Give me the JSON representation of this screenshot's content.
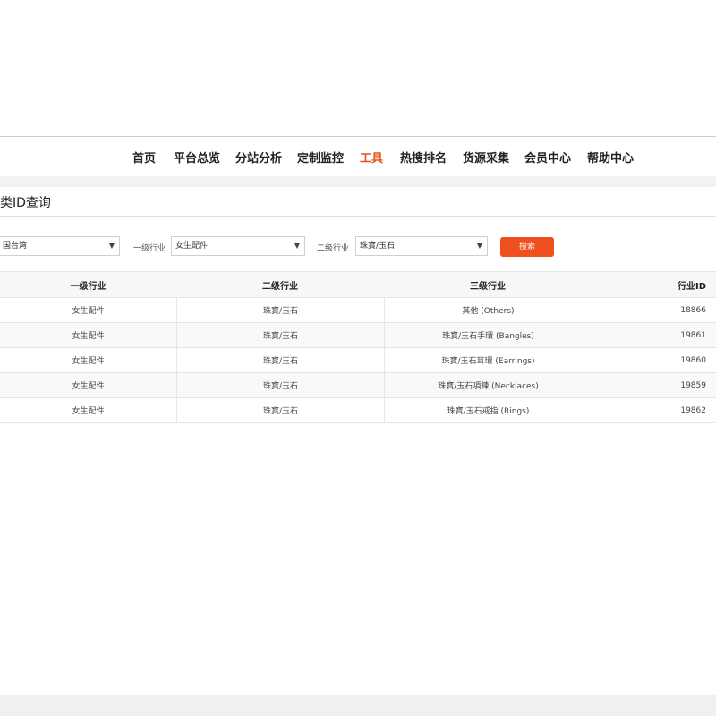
{
  "nav": {
    "items": [
      {
        "label": "首页"
      },
      {
        "label": "平台总览"
      },
      {
        "label": "分站分析"
      },
      {
        "label": "定制监控"
      },
      {
        "label": "工具"
      },
      {
        "label": "热搜排名"
      },
      {
        "label": "货源采集"
      },
      {
        "label": "会员中心"
      },
      {
        "label": "帮助中心"
      }
    ],
    "active": "工具",
    "active_color": "#e8501c"
  },
  "page": {
    "title": "类ID查询"
  },
  "filters": {
    "site_select": {
      "value": "国台湾"
    },
    "level1": {
      "label": "一级行业",
      "value": "女生配件"
    },
    "level2": {
      "label": "二级行业",
      "value": "珠寶/玉石"
    },
    "search_button": {
      "label": "搜索",
      "color": "#f0501d"
    }
  },
  "table": {
    "headers": [
      "一级行业",
      "二级行业",
      "三级行业",
      "行业ID"
    ],
    "rows": [
      [
        "女生配件",
        "珠寶/玉石",
        "其他 (Others)",
        "18866"
      ],
      [
        "女生配件",
        "珠寶/玉石",
        "珠寶/玉石手環 (Bangles)",
        "19861"
      ],
      [
        "女生配件",
        "珠寶/玉石",
        "珠寶/玉石耳環 (Earrings)",
        "19860"
      ],
      [
        "女生配件",
        "珠寶/玉石",
        "珠寶/玉石項鍊 (Necklaces)",
        "19859"
      ],
      [
        "女生配件",
        "珠寶/玉石",
        "珠寶/玉石戒指 (Rings)",
        "19862"
      ]
    ]
  }
}
